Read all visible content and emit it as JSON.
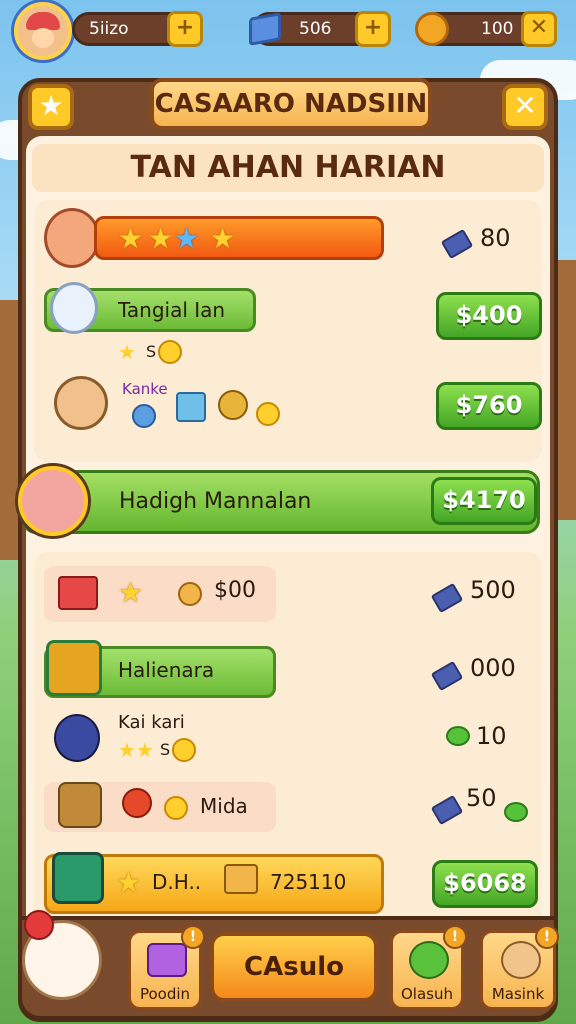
{
  "topbar": {
    "resource1": "5iizo",
    "resource2": "506",
    "resource3": "100"
  },
  "header": {
    "title": "CASAARO NADSIIN",
    "subtitle": "TAN AHAN HARIAN"
  },
  "section1": {
    "row1": {
      "reward": "80"
    },
    "row2": {
      "label": "Tangial Ian",
      "sub": "S",
      "button": "$400"
    },
    "row3": {
      "label": "Kanke",
      "button": "$760"
    }
  },
  "highlight": {
    "label": "Hadigh Mannalan",
    "button": "$4170"
  },
  "section2": {
    "row1": {
      "amount_inline": "$00",
      "reward": "500"
    },
    "row2": {
      "label": "Halienara",
      "reward": "000"
    },
    "row3": {
      "label": "Kai kari",
      "sub": "S",
      "reward": "10"
    },
    "row4": {
      "label": "Mida",
      "reward": "50"
    },
    "row5": {
      "label_a": "D.H..",
      "label_b": "725110",
      "button": "$6068"
    }
  },
  "nav": {
    "left": {
      "label": "Poodin",
      "badge": "!"
    },
    "center": {
      "label": "CAsulo"
    },
    "right1": {
      "label": "Olasuh",
      "badge": "!"
    },
    "right2": {
      "label": "Masink",
      "badge": "!"
    }
  },
  "colors": {
    "panel": "#7a4a2c",
    "accent_green": "#6cbb37",
    "accent_orange": "#f25a12",
    "accent_yellow": "#ffc928"
  }
}
